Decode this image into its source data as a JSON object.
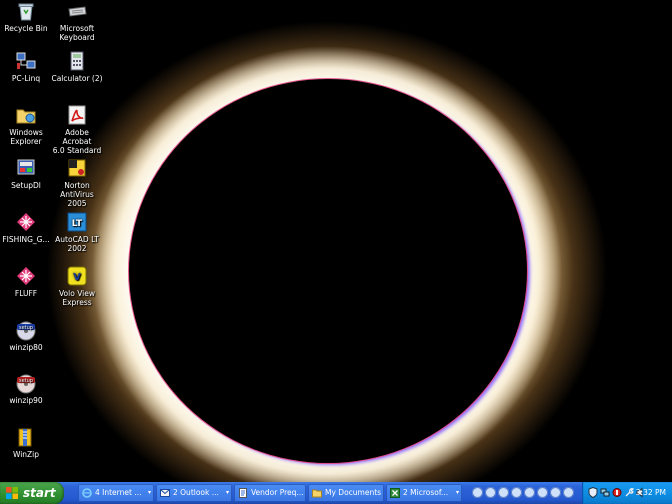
{
  "desktop": {
    "wallpaper": "solar eclipse",
    "icons": [
      {
        "name": "recycle-bin",
        "label": "Recycle Bin",
        "icon": "recycle-bin-icon"
      },
      {
        "name": "microsoft-keyboard",
        "label": "Microsoft\nKeyboard",
        "icon": "keyboard-icon"
      },
      {
        "name": "pc-linq",
        "label": "PC-Linq",
        "icon": "network-icon"
      },
      {
        "name": "calculator",
        "label": "Calculator (2)",
        "icon": "calculator-icon"
      },
      {
        "name": "windows-explorer",
        "label": "Windows\nExplorer",
        "icon": "folder-icon"
      },
      {
        "name": "adobe-acrobat",
        "label": "Adobe Acrobat\n6.0 Standard",
        "icon": "acrobat-icon"
      },
      {
        "name": "setupdl",
        "label": "SetupDl",
        "icon": "setup-icon"
      },
      {
        "name": "norton-antivirus",
        "label": "Norton\nAntiVirus 2005",
        "icon": "norton-icon"
      },
      {
        "name": "fishing-game",
        "label": "FISHING_G...",
        "icon": "pinwheel-icon"
      },
      {
        "name": "autocad-lt",
        "label": "AutoCAD LT\n2002",
        "icon": "autocad-icon"
      },
      {
        "name": "fluff",
        "label": "FLUFF",
        "icon": "pinwheel-icon"
      },
      {
        "name": "volo-view",
        "label": "Volo View\nExpress",
        "icon": "volo-view-icon"
      },
      {
        "name": "winzip80",
        "label": "winzip80",
        "icon": "setup-disc-icon"
      },
      {
        "name": "winzip90",
        "label": "winzip90",
        "icon": "setup-disc-icon"
      },
      {
        "name": "winzip",
        "label": "WinZip",
        "icon": "winzip-icon"
      }
    ]
  },
  "taskbar": {
    "start_label": "start",
    "tasks": [
      {
        "label": "4 Internet ...",
        "icon": "internet-explorer-icon"
      },
      {
        "label": "2 Outlook ...",
        "icon": "outlook-icon"
      },
      {
        "label": "Vendor Preq...",
        "icon": "document-icon"
      },
      {
        "label": "My Documents",
        "icon": "folder-icon"
      },
      {
        "label": "2 Microsof...",
        "icon": "excel-icon"
      }
    ],
    "clock": "3:32 PM"
  }
}
